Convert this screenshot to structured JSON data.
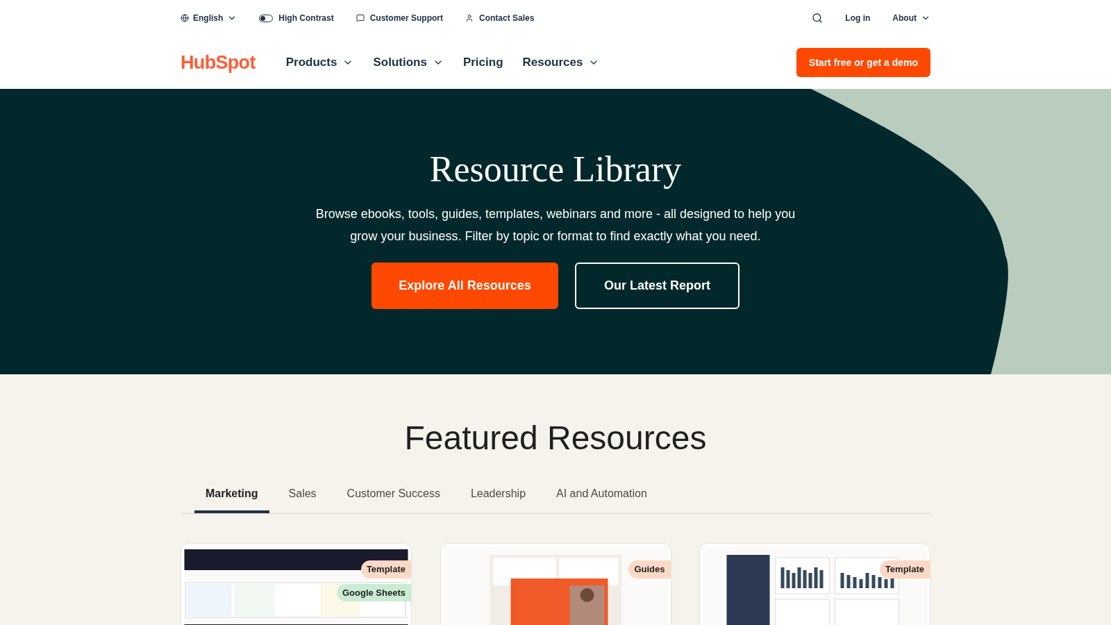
{
  "utility_bar": {
    "language": "English",
    "high_contrast": {
      "label": "High Contrast",
      "on": false
    },
    "links": [
      {
        "kind": "support",
        "label": "Customer Support"
      },
      {
        "kind": "sales",
        "label": "Contact Sales"
      }
    ],
    "login": "Log in",
    "about": "About"
  },
  "nav": {
    "logo": "HubSpot",
    "items": [
      {
        "label": "Products",
        "dropdown": true
      },
      {
        "label": "Solutions",
        "dropdown": true
      },
      {
        "label": "Pricing",
        "dropdown": false
      },
      {
        "label": "Resources",
        "dropdown": true
      }
    ],
    "cta": "Start free or get a demo"
  },
  "hero": {
    "title": "Resource Library",
    "text": "Browse ebooks, tools, guides, templates, webinars and more - all designed to help you grow your business. Filter by topic or format to find exactly what you need.",
    "primary_button": "Explore All Resources",
    "secondary_button": "Our Latest Report"
  },
  "featured": {
    "title": "Featured Resources",
    "tabs": [
      {
        "label": "Marketing",
        "selected": true
      },
      {
        "label": "Sales",
        "selected": false
      },
      {
        "label": "Customer Success",
        "selected": false
      },
      {
        "label": "Leadership",
        "selected": false
      },
      {
        "label": "AI and Automation",
        "selected": false
      }
    ],
    "cards": [
      {
        "badges": [
          {
            "label": "Template",
            "color": "#fcd9c6"
          },
          {
            "label": "Google Sheets",
            "color": "#c9ecd3"
          }
        ]
      },
      {
        "badges": [
          {
            "label": "Guides",
            "color": "#fcd9c6"
          }
        ]
      },
      {
        "badges": [
          {
            "label": "Template",
            "color": "#fcd9c6"
          }
        ]
      }
    ]
  }
}
